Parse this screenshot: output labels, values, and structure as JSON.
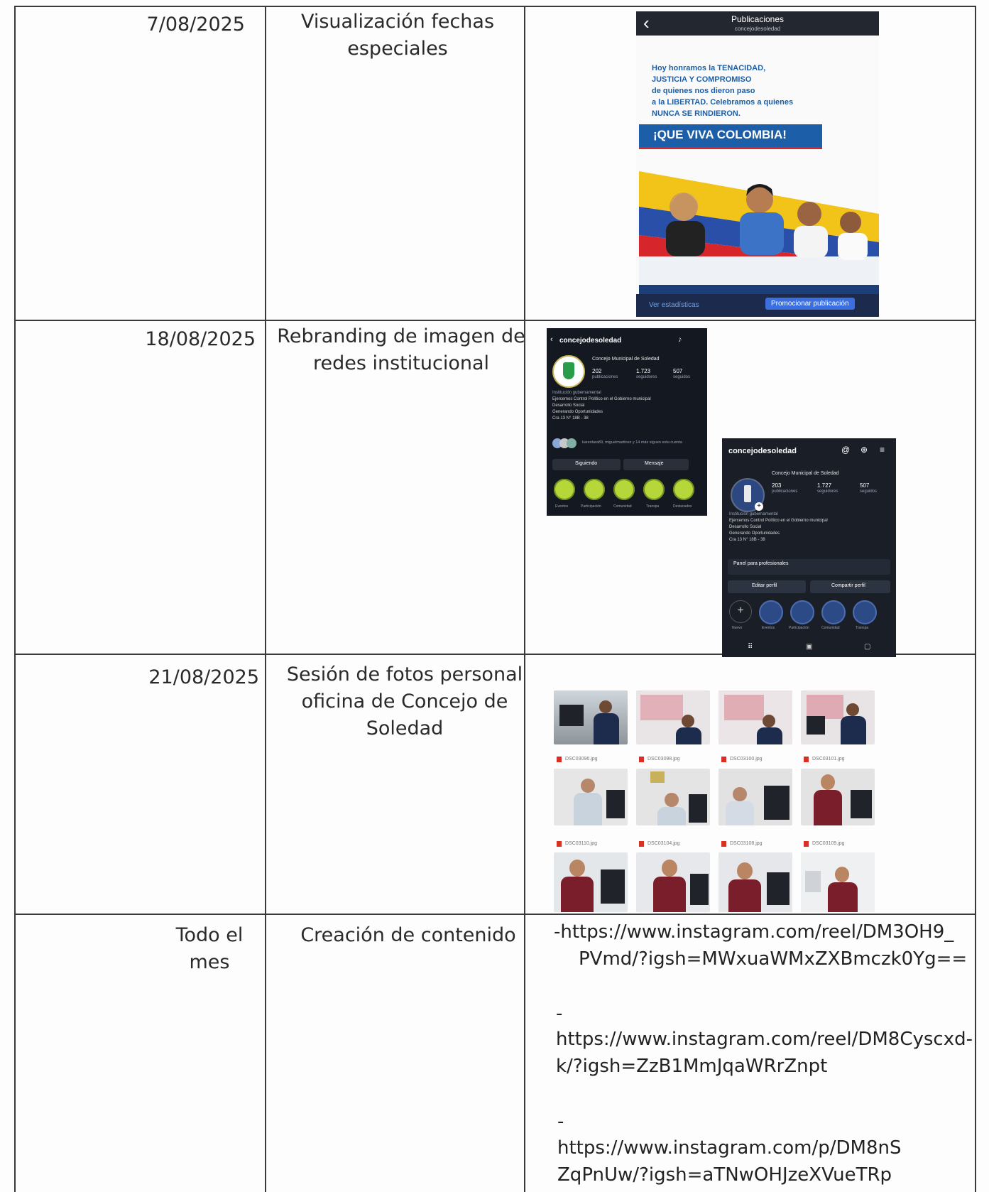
{
  "rows": [
    {
      "date": "7/08/2025",
      "desc_lines": [
        "Visualización fechas",
        "especiales"
      ]
    },
    {
      "date": "18/08/2025",
      "desc_lines": [
        "Rebranding de imagen de",
        "redes institucional"
      ]
    },
    {
      "date": "21/08/2025",
      "desc_lines": [
        "Sesión de fotos personal",
        "oficina de Concejo de",
        "Soledad"
      ]
    },
    {
      "date_lines": [
        "Todo el",
        "mes"
      ],
      "desc_lines": [
        "Creación de contenido"
      ]
    }
  ],
  "links": {
    "l1a": "-https://www.instagram.com/reel/DM3OH9_",
    "l1b": "PVmd/?igsh=MWxuaWMxZXBmczk0Yg==",
    "d2": "-",
    "l2a": "https://www.instagram.com/reel/DM8Cyscxd-",
    "l2b": "k/?igsh=ZzB1MmJqaWRrZnpt",
    "d3": "-",
    "l3a": "https://www.instagram.com/p/DM8nS",
    "l3b": "ZqPnUw/?igsh=aTNwOHJzeXVueTRp"
  },
  "post": {
    "header_title": "Publicaciones",
    "header_sub": "concejodesoledad",
    "back": "‹",
    "lines": [
      "Hoy honramos la TENACIDAD,",
      "JUSTICIA Y COMPROMISO",
      "de quienes nos dieron paso",
      "a la LIBERTAD. Celebramos a quienes",
      "NUNCA SE RINDIERON."
    ],
    "banner": "¡QUE VIVA COLOMBIA!",
    "stats": "Ver estadísticas",
    "promote": "Promocionar publicación"
  },
  "profile1": {
    "username": "concejodesoledad",
    "name": "Concejo Municipal de Soledad",
    "stats": [
      {
        "n": "202",
        "l": "publicaciones"
      },
      {
        "n": "1.723",
        "l": "seguidores"
      },
      {
        "n": "507",
        "l": "seguidos"
      }
    ],
    "bio": [
      "Institución gubernamental",
      "Ejercemos Control Político en el Gobierno municipal",
      "Desarrollo Social",
      "Generando Oportunidades",
      "Cra 13 N° 18B - 38"
    ],
    "followers_note": "karenlara89, miguelmartinez y 14 más siguen esta cuenta",
    "following_btn": "Siguiendo",
    "message_btn": "Mensaje",
    "highlights": [
      "Eventos",
      "Participación",
      "Comunidad",
      "Transpa",
      "Destacados"
    ]
  },
  "profile2": {
    "username": "concejodesoledad",
    "name": "Concejo Municipal de Soledad",
    "stats": [
      {
        "n": "203",
        "l": "publicaciones"
      },
      {
        "n": "1.727",
        "l": "seguidores"
      },
      {
        "n": "507",
        "l": "seguidos"
      }
    ],
    "bio": [
      "Institución gubernamental",
      "Ejercemos Control Político en el Gobierno municipal",
      "Desarrollo Social",
      "Generando Oportunidades",
      "Cra 13 N° 18B - 38"
    ],
    "panel": "Panel para profesionales",
    "edit_btn": "Editar perfil",
    "share_btn": "Compartir perfil",
    "highlights": [
      "Nuevo",
      "Eventos",
      "Participación",
      "Comunidad",
      "Transpa"
    ]
  },
  "photos": {
    "files": [
      "DSC03096.jpg",
      "DSC03098.jpg",
      "DSC03100.jpg",
      "DSC03101.jpg",
      "DSC03110.jpg",
      "DSC03104.jpg",
      "DSC03108.jpg",
      "DSC03109.jpg"
    ]
  },
  "colors": {
    "post_blue": "#1c5fa8",
    "flag_yellow": "#f2c318",
    "flag_red": "#d6262b",
    "ig_dark": "#141821"
  }
}
